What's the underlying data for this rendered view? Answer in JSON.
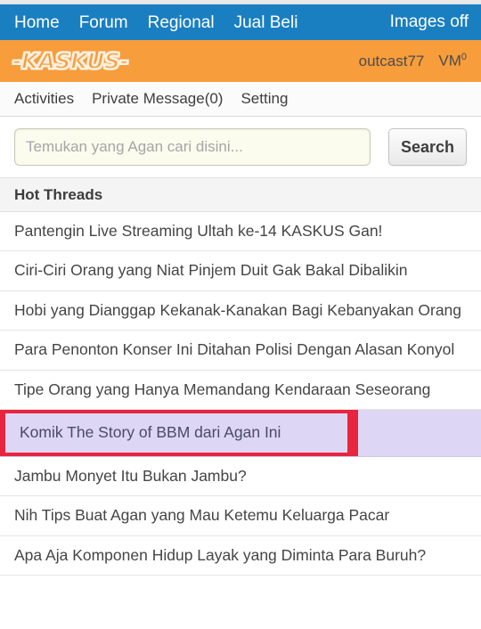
{
  "colors": {
    "primary_nav_bg": "#1a7fc1",
    "brand_bar_bg": "#f79d3c",
    "highlight_bg": "#ddd6f5",
    "highlight_border": "#e8253f",
    "search_input_bg": "#fbfbee"
  },
  "primary_nav": {
    "items": [
      {
        "label": "Home"
      },
      {
        "label": "Forum"
      },
      {
        "label": "Regional"
      },
      {
        "label": "Jual Beli"
      }
    ],
    "images_toggle_label": "Images off"
  },
  "brand_bar": {
    "logo_text": "-KASKUS-",
    "username": "outcast77",
    "vm_label": "VM",
    "vm_count": "0"
  },
  "secondary_nav": {
    "items": [
      {
        "label": "Activities"
      },
      {
        "label": "Private Message(0)"
      },
      {
        "label": "Setting"
      }
    ]
  },
  "search": {
    "value": "",
    "placeholder": "Temukan yang Agan cari disini...",
    "button_label": "Search"
  },
  "hot_threads": {
    "section_title": "Hot Threads",
    "threads": [
      {
        "title": "Pantengin Live Streaming Ultah ke-14 KASKUS Gan!",
        "highlighted": false
      },
      {
        "title": "Ciri-Ciri Orang yang Niat Pinjem Duit Gak Bakal Dibalikin",
        "highlighted": false
      },
      {
        "title": "Hobi yang Dianggap Kekanak-Kanakan Bagi Kebanyakan Orang",
        "highlighted": false
      },
      {
        "title": "Para Penonton Konser Ini Ditahan Polisi Dengan Alasan Konyol",
        "highlighted": false
      },
      {
        "title": "Tipe Orang yang Hanya Memandang Kendaraan Seseorang",
        "highlighted": false
      },
      {
        "title": "Komik The Story of BBM dari Agan Ini",
        "highlighted": true
      },
      {
        "title": "Jambu Monyet Itu Bukan Jambu?",
        "highlighted": false
      },
      {
        "title": "Nih Tips Buat Agan yang Mau Ketemu Keluarga Pacar",
        "highlighted": false
      },
      {
        "title": "Apa Aja Komponen Hidup Layak yang Diminta Para Buruh?",
        "highlighted": false
      }
    ]
  }
}
